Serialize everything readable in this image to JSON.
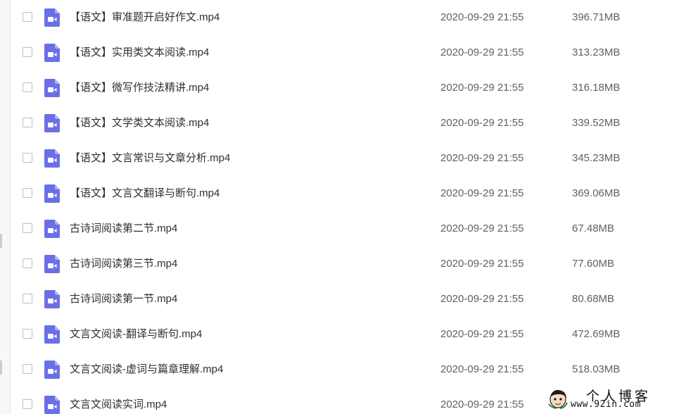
{
  "files": [
    {
      "name": "【语文】审准题开启好作文.mp4",
      "time": "2020-09-29 21:55",
      "size": "396.71MB"
    },
    {
      "name": "【语文】实用类文本阅读.mp4",
      "time": "2020-09-29 21:55",
      "size": "313.23MB"
    },
    {
      "name": "【语文】微写作技法精讲.mp4",
      "time": "2020-09-29 21:55",
      "size": "316.18MB"
    },
    {
      "name": "【语文】文学类文本阅读.mp4",
      "time": "2020-09-29 21:55",
      "size": "339.52MB"
    },
    {
      "name": "【语文】文言常识与文章分析.mp4",
      "time": "2020-09-29 21:55",
      "size": "345.23MB"
    },
    {
      "name": "【语文】文言文翻译与断句.mp4",
      "time": "2020-09-29 21:55",
      "size": "369.06MB"
    },
    {
      "name": "古诗词阅读第二节.mp4",
      "time": "2020-09-29 21:55",
      "size": "67.48MB"
    },
    {
      "name": "古诗词阅读第三节.mp4",
      "time": "2020-09-29 21:55",
      "size": "77.60MB"
    },
    {
      "name": "古诗词阅读第一节.mp4",
      "time": "2020-09-29 21:55",
      "size": "80.68MB"
    },
    {
      "name": "文言文阅读-翻译与断句.mp4",
      "time": "2020-09-29 21:55",
      "size": "472.69MB"
    },
    {
      "name": "文言文阅读-虚词与篇章理解.mp4",
      "time": "2020-09-29 21:55",
      "size": "518.03MB"
    },
    {
      "name": "文言文阅读实词.mp4",
      "time": "2020-09-29 21:55",
      "size": ""
    }
  ],
  "icon": {
    "name": "video-file-icon",
    "color": "#6b6fe6"
  },
  "watermark": {
    "title": "个人博客",
    "url": "www.92in.com"
  }
}
